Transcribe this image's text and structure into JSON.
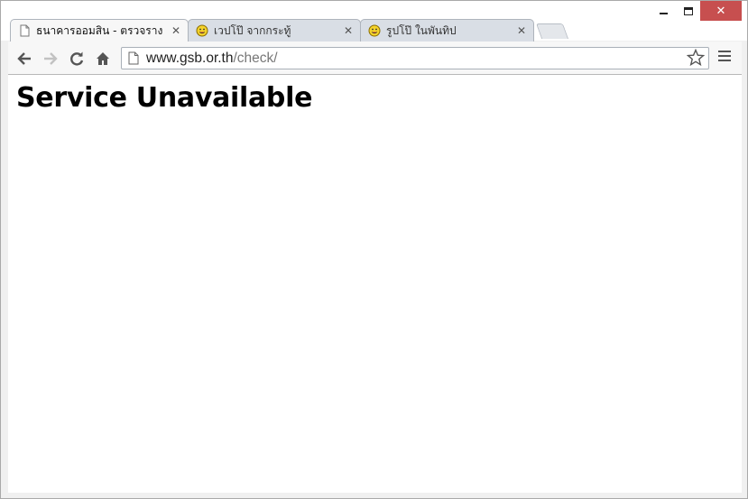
{
  "window": {
    "controls": {
      "minimize": "minimize-icon",
      "maximize": "maximize-icon",
      "close": "close-icon"
    }
  },
  "tabs": [
    {
      "title": "ธนาคารออมสิน - ตรวจราง",
      "icon": "page-icon",
      "active": true
    },
    {
      "title": "เวปโป๊ จากกระทู้",
      "icon": "smiley-icon",
      "active": false
    },
    {
      "title": "รูปโป๊ ในพันทิป",
      "icon": "smiley-icon",
      "active": false
    }
  ],
  "tab_close_glyph": "✕",
  "toolbar": {
    "back_icon": "back-arrow-icon",
    "forward_icon": "forward-arrow-icon",
    "reload_icon": "reload-icon",
    "home_icon": "home-icon"
  },
  "omnibox": {
    "url_host": "www.gsb.or.th",
    "url_path": "/check/"
  },
  "page": {
    "heading": "Service Unavailable"
  },
  "colors": {
    "close_button": "#c74f4f",
    "tab_active": "#f7f7f7",
    "tab_inactive": "#d9dee5"
  }
}
